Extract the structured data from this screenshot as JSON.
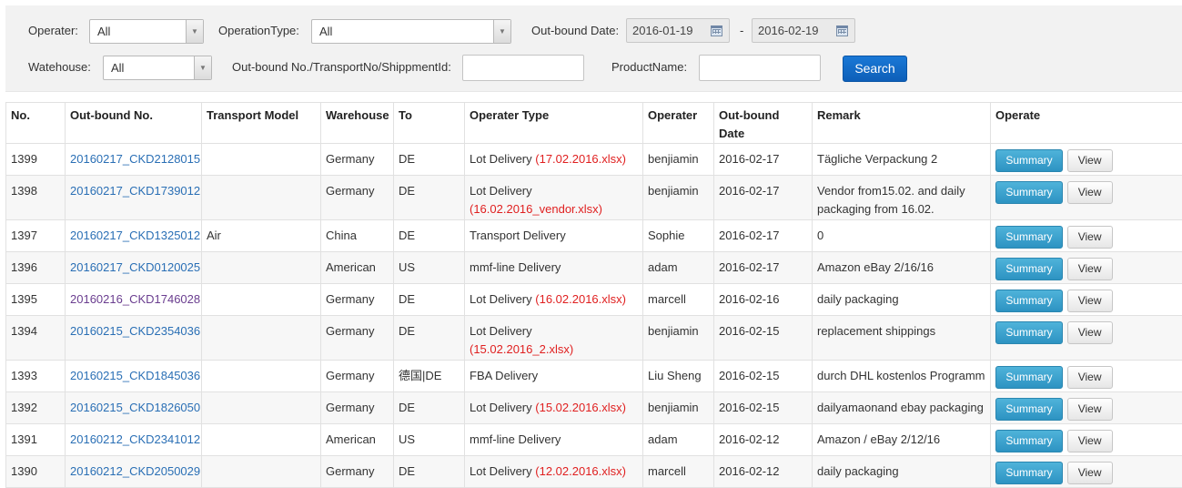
{
  "filters": {
    "operater_label": "Operater:",
    "operater_value": "All",
    "operation_type_label": "OperationType:",
    "operation_type_value": "All",
    "outbound_date_label": "Out-bound Date:",
    "date_from": "2016-01-19",
    "date_separator": "-",
    "date_to": "2016-02-19",
    "warehouse_label": "Watehouse:",
    "warehouse_value": "All",
    "number_label": "Out-bound No./TransportNo/ShippmentId:",
    "number_value": "",
    "product_label": "ProductName:",
    "product_value": "",
    "search_button": "Search"
  },
  "table": {
    "headers": [
      "No.",
      "Out-bound No.",
      "Transport Model",
      "Warehouse",
      "To",
      "Operater Type",
      "Operater",
      "Out-bound Date",
      "Remark",
      "Operate"
    ],
    "summary_label": "Summary",
    "view_label": "View",
    "rows": [
      {
        "no": "1399",
        "outbound": "20160217_CKD2128015",
        "transport": "",
        "warehouse": "Germany",
        "to": "DE",
        "type": "Lot Delivery",
        "file": "(17.02.2016.xlsx)",
        "operater": "benjiamin",
        "date": "2016-02-17",
        "remark": "Tägliche Verpackung 2"
      },
      {
        "no": "1398",
        "outbound": "20160217_CKD1739012",
        "transport": "",
        "warehouse": "Germany",
        "to": "DE",
        "type": "Lot Delivery",
        "file": "(16.02.2016_vendor.xlsx)",
        "operater": "benjiamin",
        "date": "2016-02-17",
        "remark": "Vendor from15.02. and daily packaging from 16.02."
      },
      {
        "no": "1397",
        "outbound": "20160217_CKD1325012",
        "transport": "Air",
        "warehouse": "China",
        "to": "DE",
        "type": "Transport Delivery",
        "file": "",
        "operater": "Sophie",
        "date": "2016-02-17",
        "remark": "0"
      },
      {
        "no": "1396",
        "outbound": "20160217_CKD0120025",
        "transport": "",
        "warehouse": "American",
        "to": "US",
        "type": "mmf-line Delivery",
        "file": "",
        "operater": "adam",
        "date": "2016-02-17",
        "remark": "Amazon eBay 2/16/16"
      },
      {
        "no": "1395",
        "outbound": "20160216_CKD1746028",
        "transport": "",
        "warehouse": "Germany",
        "to": "DE",
        "type": "Lot Delivery",
        "file": "(16.02.2016.xlsx)",
        "operater": "marcell",
        "date": "2016-02-16",
        "remark": "daily packaging"
      },
      {
        "no": "1394",
        "outbound": "20160215_CKD2354036",
        "transport": "",
        "warehouse": "Germany",
        "to": "DE",
        "type": "Lot Delivery",
        "file": "(15.02.2016_2.xlsx)",
        "operater": "benjiamin",
        "date": "2016-02-15",
        "remark": "replacement shippings"
      },
      {
        "no": "1393",
        "outbound": "20160215_CKD1845036",
        "transport": "",
        "warehouse": "Germany",
        "to": "德国|DE",
        "type": "FBA Delivery",
        "file": "",
        "operater": "Liu Sheng",
        "date": "2016-02-15",
        "remark": "durch DHL kostenlos Programm"
      },
      {
        "no": "1392",
        "outbound": "20160215_CKD1826050",
        "transport": "",
        "warehouse": "Germany",
        "to": "DE",
        "type": "Lot Delivery",
        "file": "(15.02.2016.xlsx)",
        "operater": "benjiamin",
        "date": "2016-02-15",
        "remark": "dailyamaonand ebay packaging"
      },
      {
        "no": "1391",
        "outbound": "20160212_CKD2341012",
        "transport": "",
        "warehouse": "American",
        "to": "US",
        "type": "mmf-line Delivery",
        "file": "",
        "operater": "adam",
        "date": "2016-02-12",
        "remark": "Amazon / eBay 2/12/16"
      },
      {
        "no": "1390",
        "outbound": "20160212_CKD2050029",
        "transport": "",
        "warehouse": "Germany",
        "to": "DE",
        "type": "Lot Delivery",
        "file": "(12.02.2016.xlsx)",
        "operater": "marcell",
        "date": "2016-02-12",
        "remark": "daily packaging"
      }
    ]
  }
}
